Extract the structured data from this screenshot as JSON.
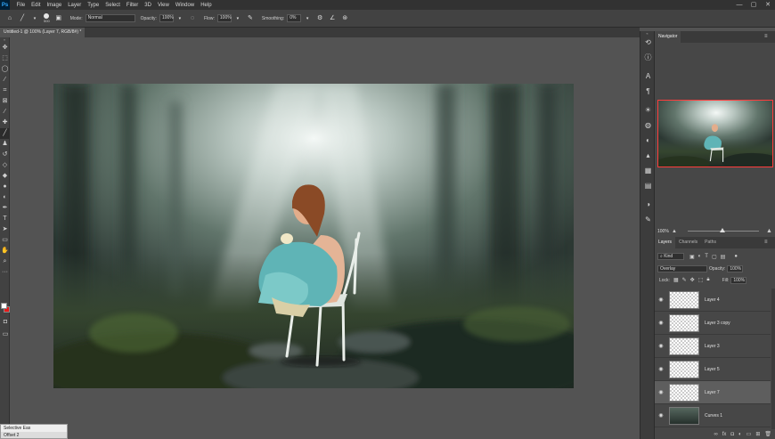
{
  "app": {
    "logo": "Ps"
  },
  "menu": [
    "File",
    "Edit",
    "Image",
    "Layer",
    "Type",
    "Select",
    "Filter",
    "3D",
    "View",
    "Window",
    "Help"
  ],
  "window_controls": [
    "—",
    "▢",
    "✕"
  ],
  "options_bar": {
    "brush_size": "500",
    "mode_label": "Mode:",
    "mode_value": "Normal",
    "opacity_label": "Opacity:",
    "opacity_value": "100%",
    "flow_label": "Flow:",
    "flow_value": "100%",
    "smoothing_label": "Smoothing:",
    "smoothing_value": "0%"
  },
  "document_tab": "Untitled-1 @ 100% (Layer 7, RGB/8#) *",
  "navigator": {
    "tab": "Navigator",
    "zoom": "100%"
  },
  "layers_panel": {
    "tabs": [
      "Layers",
      "Channels",
      "Paths"
    ],
    "kind_label": "Kind",
    "blend_mode": "Overlay",
    "opacity_label": "Opacity:",
    "opacity_value": "100%",
    "lock_label": "Lock:",
    "fill_label": "Fill:",
    "fill_value": "100%",
    "layers": [
      {
        "name": "Layer 4",
        "type": "pixel",
        "selected": false
      },
      {
        "name": "Layer 3 copy",
        "type": "pixel",
        "selected": false
      },
      {
        "name": "Layer 3",
        "type": "pixel",
        "selected": false
      },
      {
        "name": "Layer 5",
        "type": "pixel",
        "selected": false
      },
      {
        "name": "Layer 7",
        "type": "pixel",
        "selected": true
      },
      {
        "name": "Curves 1",
        "type": "adjustment",
        "selected": false
      }
    ]
  },
  "flyout": {
    "line1": "Selective Eas",
    "line2": "Offset 2"
  },
  "colors": {
    "foreground": "#ffffff",
    "background": "#e61919",
    "accent": "#31a8ff"
  }
}
